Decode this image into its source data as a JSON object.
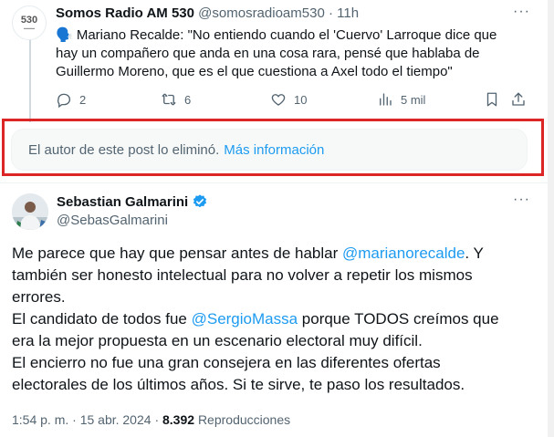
{
  "top_tweet": {
    "avatar_text": "530",
    "display_name": "Somos Radio AM 530",
    "handle": "@somosradioam530",
    "separator": "·",
    "time": "11h",
    "text_line1": "🗣️ Mariano Recalde: \"No entiendo cuando el 'Cuervo' Larroque dice que",
    "text_line2": "hay un compañero que anda en una cosa rara, pensé que hablaba de",
    "text_line3": "Guillermo Moreno, que es el que cuestiona a Axel todo el tiempo\"",
    "actions": {
      "replies": "2",
      "reposts": "6",
      "likes": "10",
      "views": "5 mil"
    },
    "icons": [
      "reply-icon",
      "repost-icon",
      "like-icon",
      "views-icon",
      "bookmark-icon",
      "share-icon"
    ]
  },
  "deleted_notice": {
    "text": "El autor de este post lo eliminó.",
    "link": "Más información"
  },
  "main_tweet": {
    "display_name": "Sebastian Galmarini",
    "handle": "@SebasGalmarini",
    "body": [
      {
        "parts": [
          "Me parece que hay que pensar  antes de hablar ",
          "@marianorecalde",
          ". Y"
        ]
      },
      {
        "parts": [
          "también ser honesto intelectual para no volver a repetir los mismos"
        ]
      },
      {
        "parts": [
          "errores."
        ]
      },
      {
        "parts": [
          "El candidato de todos fue ",
          "@SergioMassa",
          " porque TODOS creímos que"
        ]
      },
      {
        "parts": [
          "era la mejor propuesta en un escenario electoral muy difícil."
        ]
      },
      {
        "parts": [
          "El encierro no fue una gran consejera en las diferentes ofertas"
        ]
      },
      {
        "parts": [
          "electorales de los últimos años. Si te sirve, te paso los resultados."
        ]
      }
    ],
    "timestamp": "1:54 p. m. · 15 abr. 2024",
    "separator": "·",
    "views_count": "8.392",
    "views_label": "Reproducciones"
  },
  "colors": {
    "link": "#1d9bf0",
    "muted": "#536471",
    "highlight_frame": "#dc2626",
    "verified": "#1d9bf0"
  }
}
